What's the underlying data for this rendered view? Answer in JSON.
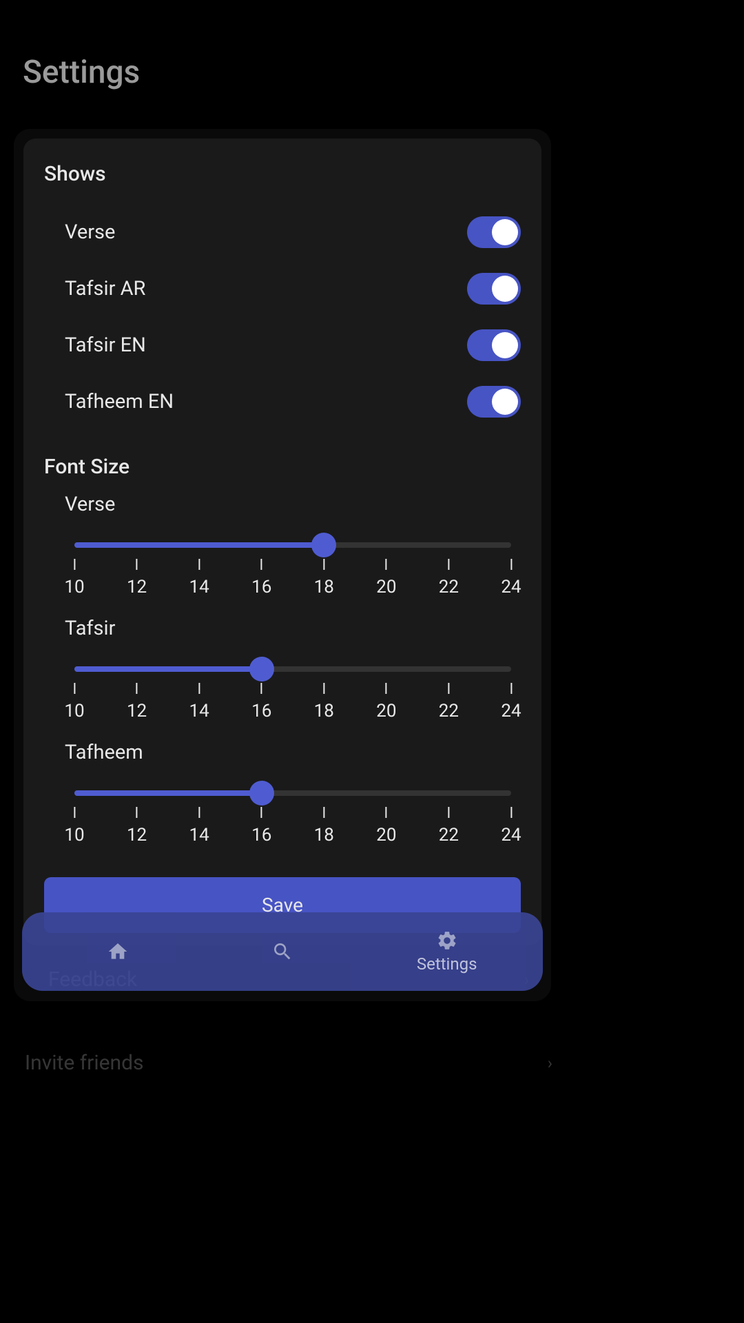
{
  "page": {
    "title": "Settings"
  },
  "shows": {
    "title": "Shows",
    "items": [
      {
        "label": "Verse",
        "on": true
      },
      {
        "label": "Tafsir AR",
        "on": true
      },
      {
        "label": "Tafsir EN",
        "on": true
      },
      {
        "label": "Tafheem EN",
        "on": true
      }
    ]
  },
  "fontSize": {
    "title": "Font Size",
    "sliders": [
      {
        "label": "Verse",
        "value": 18,
        "min": 10,
        "max": 24,
        "ticks": [
          10,
          12,
          14,
          16,
          18,
          20,
          22,
          24
        ]
      },
      {
        "label": "Tafsir",
        "value": 16,
        "min": 10,
        "max": 24,
        "ticks": [
          10,
          12,
          14,
          16,
          18,
          20,
          22,
          24
        ]
      },
      {
        "label": "Tafheem",
        "value": 16,
        "min": 10,
        "max": 24,
        "ticks": [
          10,
          12,
          14,
          16,
          18,
          20,
          22,
          24
        ]
      }
    ]
  },
  "actions": {
    "save": "Save"
  },
  "menu": {
    "feedback": "Feedback",
    "invite": "Invite friends"
  },
  "nav": {
    "settings": "Settings"
  },
  "colors": {
    "accent": "#4754c4",
    "background": "#000000",
    "card": "#1a1a1a"
  }
}
